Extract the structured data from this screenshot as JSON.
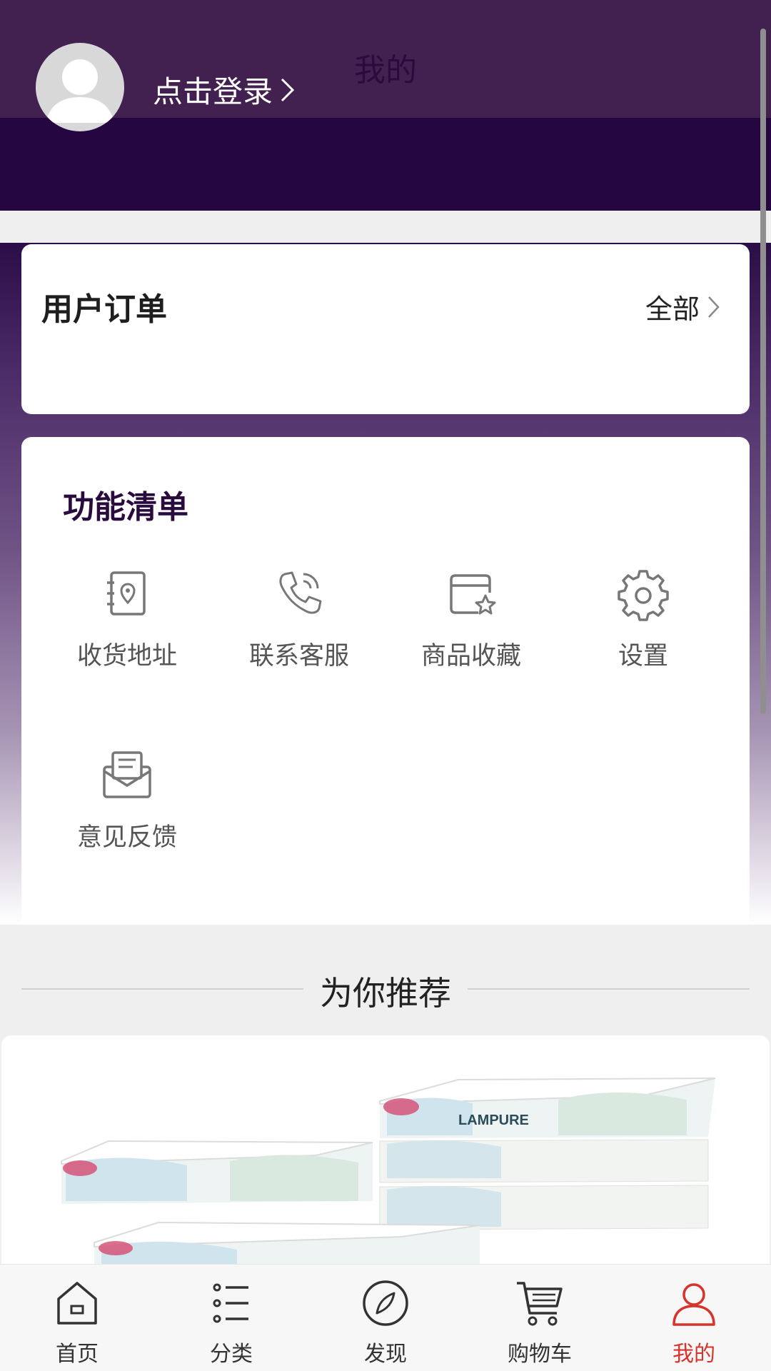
{
  "header": {
    "page_title": "我的",
    "login_label": "点击登录"
  },
  "orders": {
    "title": "用户订单",
    "all_label": "全部"
  },
  "functions": {
    "title": "功能清单",
    "items": [
      {
        "label": "收货地址",
        "icon": "address-book-icon"
      },
      {
        "label": "联系客服",
        "icon": "phone-icon"
      },
      {
        "label": "商品收藏",
        "icon": "favorites-icon"
      },
      {
        "label": "设置",
        "icon": "gear-icon"
      },
      {
        "label": "意见反馈",
        "icon": "mail-icon"
      }
    ]
  },
  "recommend": {
    "title": "为你推荐",
    "product_brand": "LAMPURE"
  },
  "tabbar": {
    "items": [
      {
        "label": "首页",
        "icon": "home-icon"
      },
      {
        "label": "分类",
        "icon": "list-icon"
      },
      {
        "label": "发现",
        "icon": "compass-icon"
      },
      {
        "label": "购物车",
        "icon": "cart-icon"
      },
      {
        "label": "我的",
        "icon": "user-icon",
        "active": true
      }
    ],
    "active_color": "#d8332b"
  },
  "colors": {
    "header": "#42204f",
    "accent": "#d8332b"
  }
}
